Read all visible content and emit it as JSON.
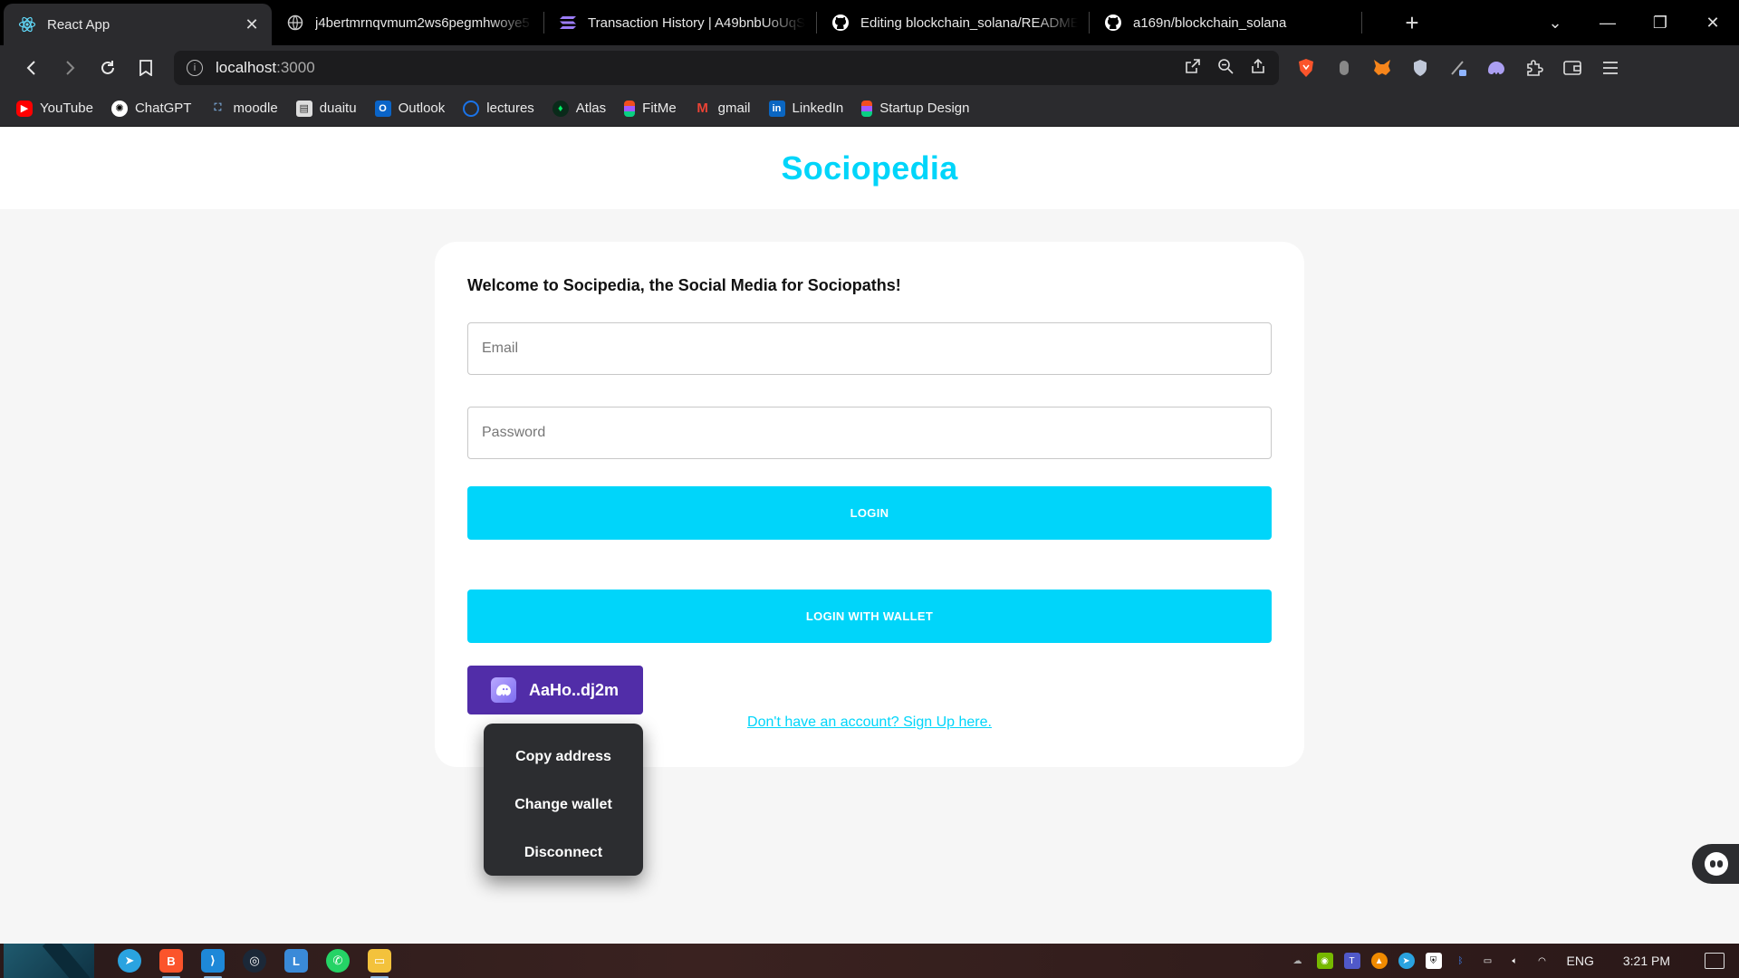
{
  "browser": {
    "tabs": [
      {
        "label": "React App",
        "active": true
      },
      {
        "label": "j4bertmrnqvmum2ws6pegmhwoye5",
        "active": false
      },
      {
        "label": "Transaction History | A49bnbUoUqS4",
        "active": false
      },
      {
        "label": "Editing blockchain_solana/README.m",
        "active": false
      },
      {
        "label": "a169n/blockchain_solana",
        "active": false
      }
    ],
    "address": {
      "host": "localhost",
      "port": ":3000"
    },
    "bookmarks": [
      {
        "label": "YouTube",
        "color": "#ff0000",
        "icon": "youtube-icon"
      },
      {
        "label": "ChatGPT",
        "color": "#444444",
        "icon": "chatgpt-icon"
      },
      {
        "label": "moodle",
        "color": "#2a6aa8",
        "icon": "moodle-icon"
      },
      {
        "label": "duaitu",
        "color": "#666666",
        "icon": "duaitu-icon"
      },
      {
        "label": "Outlook",
        "color": "#0a64c8",
        "icon": "outlook-icon"
      },
      {
        "label": "lectures",
        "color": "#1a73e8",
        "icon": "lectures-icon"
      },
      {
        "label": "Atlas",
        "color": "#00a35c",
        "icon": "atlas-icon"
      },
      {
        "label": "FitMe",
        "color": "#f24e1e",
        "icon": "figma-icon"
      },
      {
        "label": "gmail",
        "color": "#ea4335",
        "icon": "gmail-icon"
      },
      {
        "label": "LinkedIn",
        "color": "#0a66c2",
        "icon": "linkedin-icon"
      },
      {
        "label": "Startup Design",
        "color": "#f24e1e",
        "icon": "figma-icon"
      }
    ]
  },
  "app": {
    "brand": "Sociopedia",
    "welcome": "Welcome to Socipedia, the Social Media for Sociopaths!",
    "email_placeholder": "Email",
    "password_placeholder": "Password",
    "login_label": "LOGIN",
    "wallet_login_label": "LOGIN WITH WALLET",
    "wallet_address": "AaHo..dj2m",
    "signup_link": "Don't have an account? Sign Up here.",
    "wallet_menu": [
      "Copy address",
      "Change wallet",
      "Disconnect"
    ],
    "accent_color": "#00d5fa",
    "wallet_color": "#512da8"
  },
  "taskbar": {
    "lang": "ENG",
    "time": "3:21 PM"
  }
}
